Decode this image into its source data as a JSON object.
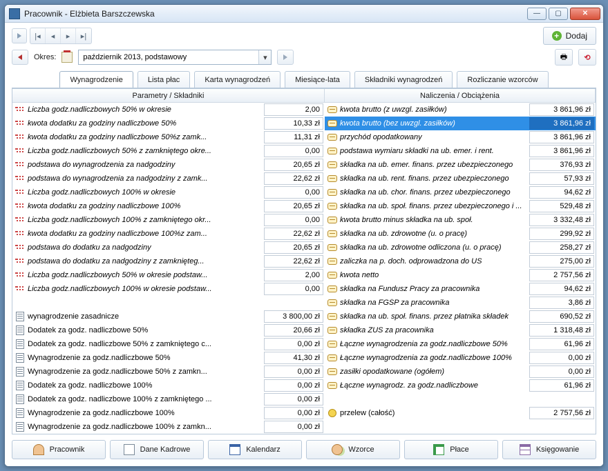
{
  "window": {
    "title": "Pracownik - Elżbieta Barszczewska"
  },
  "toolbar": {
    "add": "Dodaj"
  },
  "period": {
    "label": "Okres:",
    "value": "październik 2013, podstawowy"
  },
  "tabs": [
    {
      "label": "Wynagrodzenie",
      "active": true
    },
    {
      "label": "Lista płac"
    },
    {
      "label": "Karta wynagrodzeń"
    },
    {
      "label": "Miesiące-lata"
    },
    {
      "label": "Składniki wynagrodzeń"
    },
    {
      "label": "Rozliczanie wzorców"
    }
  ],
  "grid": {
    "left_header": "Parametry / Składniki",
    "right_header": "Naliczenia / Obciążenia"
  },
  "left_rows": [
    {
      "icon": "dots",
      "label": "Liczba godz.nadliczbowych 50% w okresie",
      "value": "2,00"
    },
    {
      "icon": "dots",
      "label": "kwota dodatku za godziny nadliczbowe 50%",
      "value": "10,33 zł"
    },
    {
      "icon": "dots",
      "label": "kwota dodatku za godziny nadliczbowe 50%z zamk...",
      "value": "11,31 zł"
    },
    {
      "icon": "dots",
      "label": "Liczba godz.nadliczbowych 50% z zamkniętego okre...",
      "value": "0,00"
    },
    {
      "icon": "dots",
      "label": "podstawa do wynagrodzenia za nadgodziny",
      "value": "20,65 zł"
    },
    {
      "icon": "dots",
      "label": "podstawa do wynagrodzenia za nadgodziny z zamk...",
      "value": "22,62 zł"
    },
    {
      "icon": "dots",
      "label": "Liczba godz.nadliczbowych 100% w okresie",
      "value": "0,00"
    },
    {
      "icon": "dots",
      "label": "kwota dodatku za godziny nadliczbowe 100%",
      "value": "20,65 zł"
    },
    {
      "icon": "dots",
      "label": "Liczba godz.nadliczbowych 100% z zamkniętego okr...",
      "value": "0,00"
    },
    {
      "icon": "dots",
      "label": "kwota dodatku za godziny nadliczbowe 100%z zam...",
      "value": "22,62 zł"
    },
    {
      "icon": "dots",
      "label": "podstawa do dodatku za nadgodziny",
      "value": "20,65 zł"
    },
    {
      "icon": "dots",
      "label": "podstawa do dodatku za nadgodziny z zamknięteg...",
      "value": "22,62 zł"
    },
    {
      "icon": "dots",
      "label": "Liczba godz.nadliczbowych 50% w okresie podstaw...",
      "value": "2,00"
    },
    {
      "icon": "dots",
      "label": "Liczba godz.nadliczbowych 100% w okresie podstaw...",
      "value": "0,00"
    },
    {
      "blank": true
    },
    {
      "icon": "doc",
      "label": "wynagrodzenie zasadnicze",
      "value": "3 800,00 zł",
      "nonitalic": true
    },
    {
      "icon": "doc",
      "label": "Dodatek za godz. nadliczbowe 50%",
      "value": "20,66 zł",
      "nonitalic": true
    },
    {
      "icon": "doc",
      "label": "Dodatek za godz. nadliczbowe 50% z zamkniętego c...",
      "value": "0,00 zł",
      "nonitalic": true
    },
    {
      "icon": "doc",
      "label": "Wynagrodzenie za godz.nadliczbowe 50%",
      "value": "41,30 zł",
      "nonitalic": true
    },
    {
      "icon": "doc",
      "label": "Wynagrodzenie za godz.nadliczbowe 50% z zamkn...",
      "value": "0,00 zł",
      "nonitalic": true
    },
    {
      "icon": "doc",
      "label": "Dodatek za godz. nadliczbowe 100%",
      "value": "0,00 zł",
      "nonitalic": true
    },
    {
      "icon": "doc",
      "label": "Dodatek za godz. nadliczbowe 100% z zamkniętego ...",
      "value": "0,00 zł",
      "nonitalic": true
    },
    {
      "icon": "doc",
      "label": "Wynagrodzenie za godz.nadliczbowe 100%",
      "value": "0,00 zł",
      "nonitalic": true
    },
    {
      "icon": "doc",
      "label": "Wynagrodzenie za godz.nadliczbowe 100% z zamkn...",
      "value": "0,00 zł",
      "nonitalic": true
    }
  ],
  "right_rows": [
    {
      "icon": "link",
      "label": "kwota brutto (z uwzgl. zasiłków)",
      "value": "3 861,96 zł"
    },
    {
      "icon": "link",
      "label": "kwota brutto (bez uwzgl. zasiłków)",
      "value": "3 861,96 zł",
      "selected": true
    },
    {
      "icon": "link",
      "label": "przychód opodatkowany",
      "value": "3 861,96 zł"
    },
    {
      "icon": "link",
      "label": "podstawa wymiaru składki na ub. emer. i rent.",
      "value": "3 861,96 zł"
    },
    {
      "icon": "link",
      "label": "składka na ub. emer. finans. przez ubezpieczonego",
      "value": "376,93 zł"
    },
    {
      "icon": "link",
      "label": "składka na ub. rent. finans. przez ubezpieczonego",
      "value": "57,93 zł"
    },
    {
      "icon": "link",
      "label": "składka na ub. chor. finans. przez ubezpieczonego",
      "value": "94,62 zł"
    },
    {
      "icon": "link",
      "label": "składka na ub. społ. finans. przez ubezpieczonego i ...",
      "value": "529,48 zł"
    },
    {
      "icon": "link",
      "label": "kwota brutto minus składka na ub. społ.",
      "value": "3 332,48 zł"
    },
    {
      "icon": "link",
      "label": "składka na ub. zdrowotne (u. o pracę)",
      "value": "299,92 zł"
    },
    {
      "icon": "link",
      "label": "składka na ub. zdrowotne odliczona (u. o pracę)",
      "value": "258,27 zł"
    },
    {
      "icon": "link",
      "label": "zaliczka na p. doch. odprowadzona do US",
      "value": "275,00 zł"
    },
    {
      "icon": "link",
      "label": "kwota netto",
      "value": "2 757,56 zł"
    },
    {
      "icon": "link",
      "label": "składka na Fundusz Pracy za pracownika",
      "value": "94,62 zł"
    },
    {
      "icon": "link",
      "label": "składka na FGŚP za pracownika",
      "value": "3,86 zł"
    },
    {
      "icon": "link",
      "label": "składka na ub. społ. finans. przez płatnika składek",
      "value": "690,52 zł"
    },
    {
      "icon": "link",
      "label": "składka ZUS za pracownika",
      "value": "1 318,48 zł"
    },
    {
      "icon": "link",
      "label": "Łączne wynagrodzenia za godz.nadliczbowe 50%",
      "value": "61,96 zł"
    },
    {
      "icon": "link",
      "label": "Łączne wynagrodzenia za godz.nadliczbowe 100%",
      "value": "0,00 zł"
    },
    {
      "icon": "link",
      "label": "zasiłki opodatkowane (ogółem)",
      "value": "0,00 zł"
    },
    {
      "icon": "link",
      "label": "Łączne wynagrodz. za godz.nadliczbowe",
      "value": "61,96 zł"
    },
    {
      "blank": true
    },
    {
      "icon": "coin",
      "label": "przelew (całość)",
      "value": "2 757,56 zł",
      "nonitalic": true
    }
  ],
  "bottom": [
    {
      "icon": "person",
      "label": "Pracownik"
    },
    {
      "icon": "doc2",
      "label": "Dane Kadrowe"
    },
    {
      "icon": "cal",
      "label": "Kalendarz"
    },
    {
      "icon": "people",
      "label": "Wzorce"
    },
    {
      "icon": "grid",
      "label": "Płace"
    },
    {
      "icon": "list",
      "label": "Księgowanie"
    }
  ]
}
